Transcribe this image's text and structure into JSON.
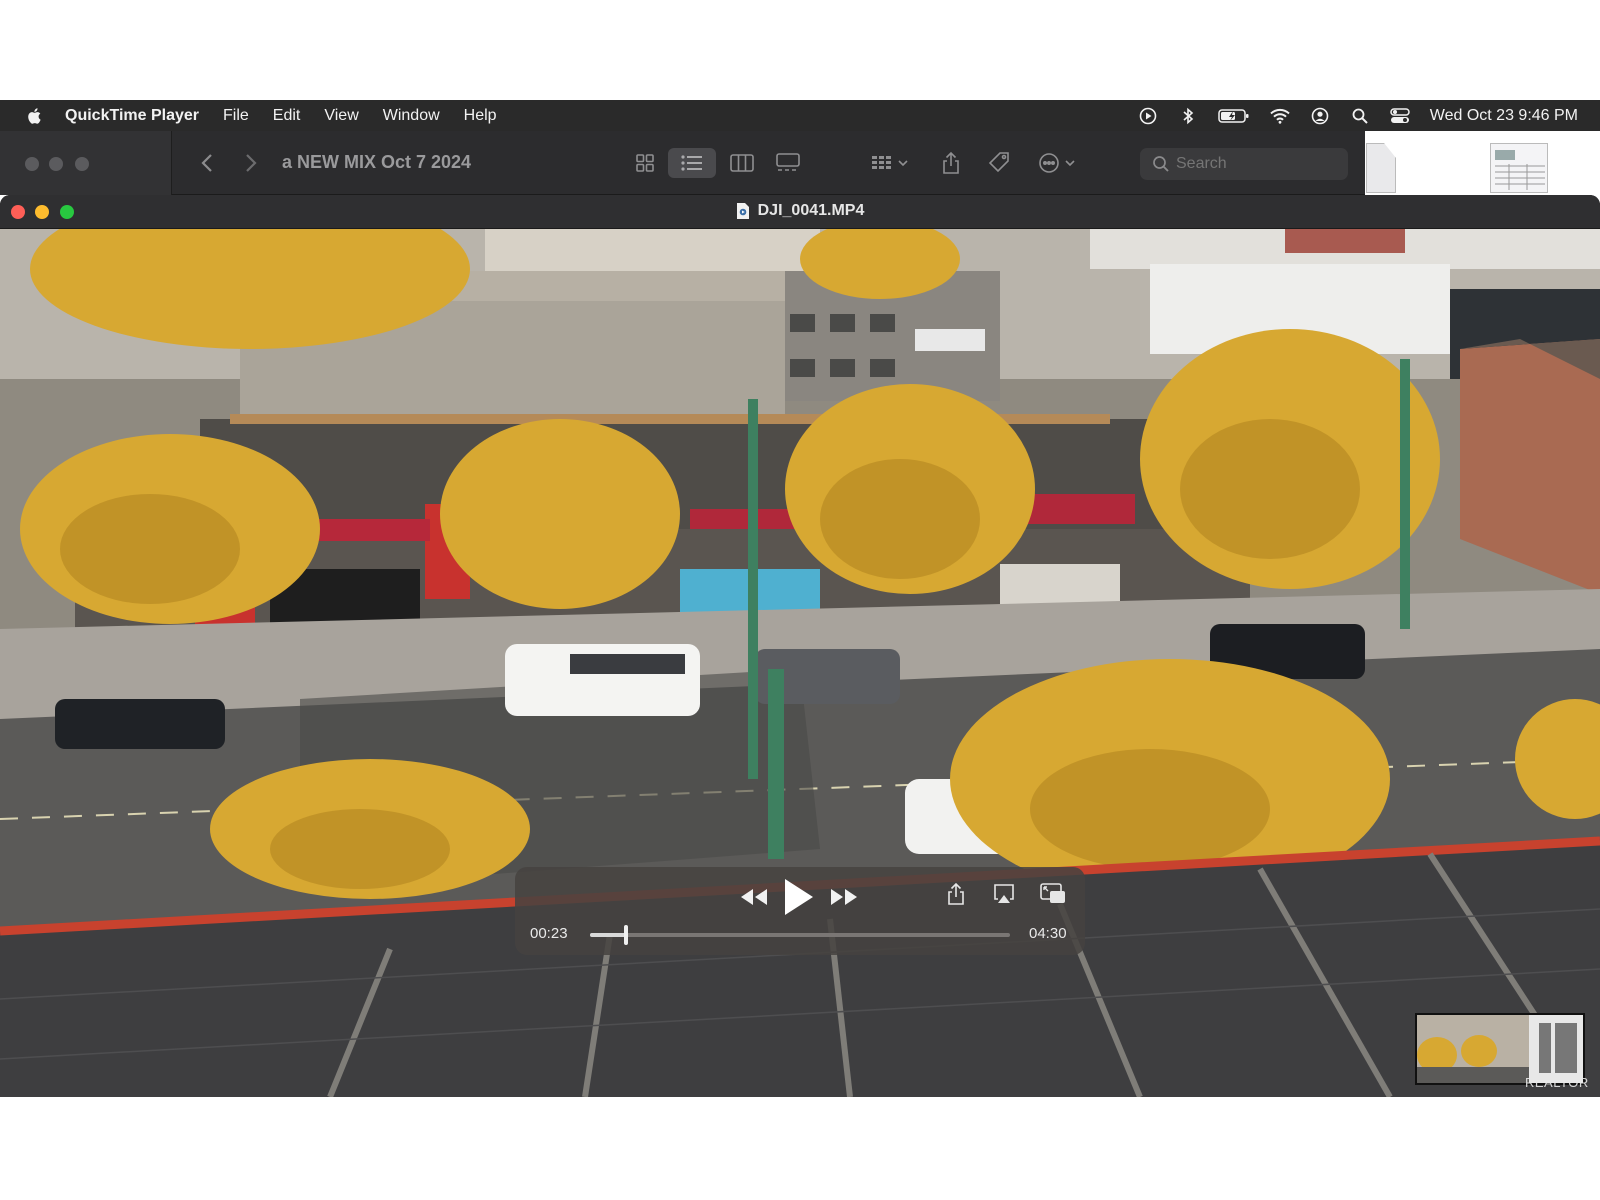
{
  "menubar": {
    "app_name": "QuickTime Player",
    "items": [
      "File",
      "Edit",
      "View",
      "Window",
      "Help"
    ],
    "clock": "Wed Oct 23  9:46 PM"
  },
  "finder": {
    "title": "a NEW MIX Oct 7 2024",
    "search_placeholder": "Search"
  },
  "quicktime": {
    "file_title": "DJI_0041.MP4",
    "elapsed": "00:23",
    "duration": "04:30",
    "progress_fraction": 0.085
  },
  "watermark": "REALTOR",
  "colors": {
    "close": "#ff5f57",
    "minimize": "#febc2e",
    "zoom": "#28c840"
  }
}
